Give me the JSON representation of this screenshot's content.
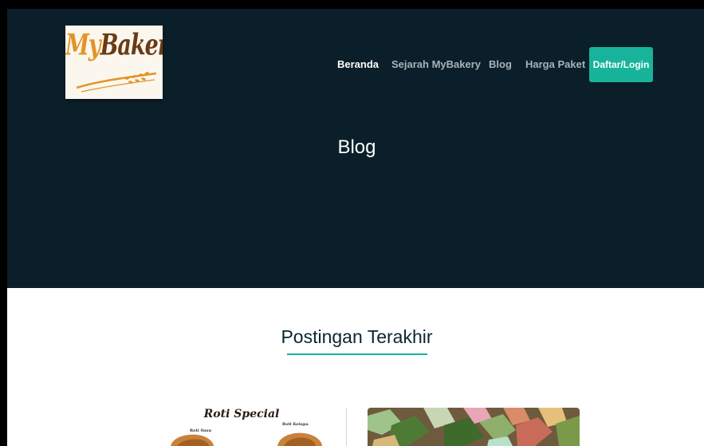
{
  "header": {
    "logo_my": "My",
    "logo_bakery": "Bakery",
    "nav": [
      {
        "label": "Beranda",
        "active": true
      },
      {
        "label": "Sejarah MyBakery",
        "active": false
      },
      {
        "label": "Blog",
        "active": false
      },
      {
        "label": "Harga Paket",
        "active": false
      }
    ],
    "cta_label": "Daftar/Login"
  },
  "hero": {
    "title": "Blog"
  },
  "section": {
    "title": "Postingan Terakhir"
  },
  "posts": [
    {
      "image_title": "Roti Special",
      "image_small_left": "Roti Susu",
      "image_small_right": "Roti Kelapa"
    },
    {
      "image_icon": "kue-photo"
    }
  ],
  "colors": {
    "hero_bg": "#0a1f29",
    "accent": "#17b49b",
    "nav_inactive": "#a7b3b8"
  }
}
